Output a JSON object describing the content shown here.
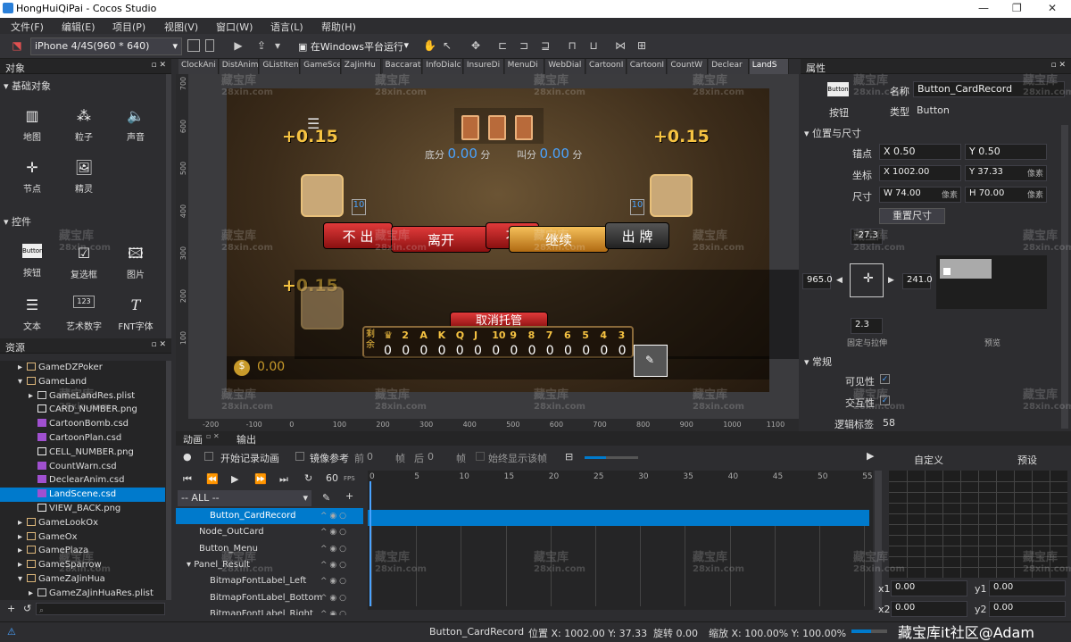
{
  "window": {
    "title": "HongHuiQiPai - Cocos Studio"
  },
  "menu": [
    "文件(F)",
    "编辑(E)",
    "项目(P)",
    "视图(V)",
    "窗口(W)",
    "语言(L)",
    "帮助(H)"
  ],
  "toolbar": {
    "device": "iPhone 4/4S(960 * 640)",
    "run_platform": "在Windows平台运行"
  },
  "objects_panel": {
    "title": "对象",
    "basic_section": "基础对象",
    "basic_items": [
      "地图",
      "粒子",
      "声音",
      "节点",
      "精灵"
    ],
    "controls_section": "控件",
    "control_items": [
      "按钮",
      "复选框",
      "图片",
      "文本",
      "艺术数字",
      "FNT字体"
    ],
    "button_icon_text": "Button",
    "artnum_icon_text": "123"
  },
  "resources_panel": {
    "title": "资源",
    "items": [
      {
        "label": "GameDZPoker",
        "indent": 1,
        "kind": "folder",
        "open": false
      },
      {
        "label": "GameLand",
        "indent": 1,
        "kind": "folder",
        "open": true
      },
      {
        "label": "GameLandRes.plist",
        "indent": 2,
        "kind": "plist",
        "open": false
      },
      {
        "label": "CARD_NUMBER.png",
        "indent": 2,
        "kind": "png"
      },
      {
        "label": "CartoonBomb.csd",
        "indent": 2,
        "kind": "csd"
      },
      {
        "label": "CartoonPlan.csd",
        "indent": 2,
        "kind": "csd"
      },
      {
        "label": "CELL_NUMBER.png",
        "indent": 2,
        "kind": "png"
      },
      {
        "label": "CountWarn.csd",
        "indent": 2,
        "kind": "csd"
      },
      {
        "label": "DeclearAnim.csd",
        "indent": 2,
        "kind": "csd"
      },
      {
        "label": "LandScene.csd",
        "indent": 2,
        "kind": "csd",
        "selected": true
      },
      {
        "label": "VIEW_BACK.png",
        "indent": 2,
        "kind": "png"
      },
      {
        "label": "GameLookOx",
        "indent": 1,
        "kind": "folder",
        "open": false
      },
      {
        "label": "GameOx",
        "indent": 1,
        "kind": "folder",
        "open": false
      },
      {
        "label": "GamePlaza",
        "indent": 1,
        "kind": "folder",
        "open": false
      },
      {
        "label": "GameSparrow",
        "indent": 1,
        "kind": "folder",
        "open": false
      },
      {
        "label": "GameZaJinHua",
        "indent": 1,
        "kind": "folder",
        "open": true
      },
      {
        "label": "GameZaJinHuaRes.plist",
        "indent": 2,
        "kind": "plist"
      }
    ]
  },
  "tabs": [
    "ClockAni",
    "DistAnim",
    "GListIten",
    "GameSce",
    "ZaJinHu",
    "Baccarat",
    "InfoDialc",
    "InsureDi",
    "MenuDi",
    "WebDial",
    "CartoonI",
    "CartoonI",
    "CountW",
    "Declear",
    "LandS"
  ],
  "rulers": {
    "v": [
      "700",
      "600",
      "500",
      "400",
      "300",
      "200",
      "100"
    ],
    "h": [
      "-200",
      "-100",
      "0",
      "100",
      "200",
      "300",
      "400",
      "500",
      "600",
      "700",
      "800",
      "900",
      "1000",
      "1100"
    ]
  },
  "scene": {
    "score_tl": "+0.15",
    "score_tr": "+0.15",
    "score_ml": "+0.15",
    "base_label": "底分",
    "base_value": "0.00",
    "base_unit": "分",
    "call_label": "叫分",
    "call_value": "0.00",
    "call_unit": "分",
    "count_left": "10",
    "count_right": "10",
    "btn_buchu": "不 出",
    "btn_likai": "离开",
    "btn_bu": "不",
    "btn_jixu": "继续",
    "btn_chupai": "出 牌",
    "btn_cancel": "取消托管",
    "remaining_label": "剩余",
    "ranks": [
      "♛",
      "2",
      "A",
      "K",
      "Q",
      "J",
      "10",
      "9",
      "8",
      "7",
      "6",
      "5",
      "4",
      "3"
    ],
    "rank_counts": [
      "0",
      "0",
      "0",
      "0",
      "0",
      "0",
      "0",
      "0",
      "0",
      "0",
      "0",
      "0",
      "0",
      "0"
    ],
    "gold": "0.00"
  },
  "properties": {
    "title": "属性",
    "widget_type_icon": "Button",
    "widget_type_label": "按钮",
    "name_label": "名称",
    "name_value": "Button_CardRecord",
    "type_label": "类型",
    "type_value": "Button",
    "pos_section": "位置与尺寸",
    "anchor_label": "锚点",
    "anchor_x": "X  0.50",
    "anchor_y": "Y  0.50",
    "pos_label": "坐标",
    "pos_x": "X  1002.00",
    "pos_y": "Y  37.33",
    "size_label": "尺寸",
    "size_w": "W  74.00",
    "size_h": "H  70.00",
    "unit": "像素",
    "reset_size": "重置尺寸",
    "margin_top": "-27.3",
    "margin_left": "965.0",
    "margin_right": "241.0",
    "margin_bottom": "2.3",
    "fixed_stretch": "固定与拉伸",
    "preview": "预览",
    "general_section": "常规",
    "visible_label": "可见性",
    "interact_label": "交互性",
    "tag_label": "逻辑标签",
    "tag_value": "58"
  },
  "animation": {
    "tab_anim": "动画",
    "tab_output": "输出",
    "record": "开始记录动画",
    "mirror": "镜像参考",
    "prev": "前",
    "prev_val": "0",
    "frame": "帧",
    "next": "后",
    "next_val": "0",
    "always_show": "始终显示该帧",
    "fps_value": "60",
    "fps_label": "FPS",
    "all_filter": "-- ALL --",
    "layers": [
      {
        "label": "Button_CardRecord",
        "indent": 2,
        "selected": true
      },
      {
        "label": "Node_OutCard",
        "indent": 1
      },
      {
        "label": "Button_Menu",
        "indent": 1
      },
      {
        "label": "Panel_Result",
        "indent": 1
      },
      {
        "label": "BitmapFontLabel_Left",
        "indent": 2
      },
      {
        "label": "BitmapFontLabel_Bottom",
        "indent": 2
      },
      {
        "label": "BitmapFontLabel_Right",
        "indent": 2
      }
    ],
    "frame_marks": [
      "0",
      "5",
      "10",
      "15",
      "20",
      "25",
      "30",
      "35",
      "40",
      "45",
      "50",
      "55"
    ],
    "curve_tab_custom": "自定义",
    "curve_tab_preset": "预设",
    "x1": "x1",
    "x1_val": "0.00",
    "y1": "y1",
    "y1_val": "0.00",
    "x2": "x2",
    "x2_val": "0.00",
    "y2": "y2",
    "y2_val": "0.00"
  },
  "statusbar": {
    "name": "Button_CardRecord",
    "pos": "位置 X: 1002.00  Y: 37.33",
    "rot": "旋转 0.00",
    "scale": "缩放 X: 100.00%  Y: 100.00%",
    "brand": "藏宝库it社区@Adam"
  },
  "watermark": {
    "text": "藏宝库",
    "sub": "28xin.com"
  }
}
